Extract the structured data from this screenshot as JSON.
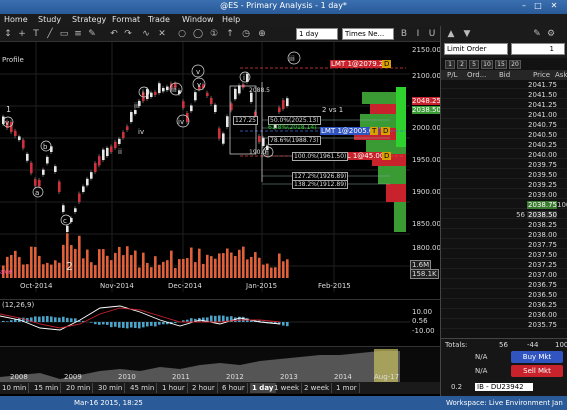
{
  "window": {
    "title": "@ES - Primary Analysis - 1 day*"
  },
  "menu": [
    "Home",
    "Study",
    "Strategy",
    "Format",
    "Trade",
    "Window",
    "Help"
  ],
  "toolbar": {
    "interval": "1 day",
    "font": "Times Ne..."
  },
  "chart": {
    "profile_label": "Profile",
    "price_axis": [
      "2150.00",
      "2100.00",
      "2050.00",
      "2000.00",
      "1950.00",
      "1900.00",
      "1850.00",
      "1800.00"
    ],
    "price_tags": [
      "2048.25",
      "2038.50"
    ],
    "date_axis": [
      "Oct-2014",
      "Nov-2014",
      "Dec-2014",
      "Jan-2015",
      "Feb-2015"
    ],
    "wave_labels": [
      "1",
      "v",
      "b",
      "a",
      "c",
      "ii",
      "iii",
      "iv",
      "i",
      "v",
      "iii",
      "iv",
      "i",
      "ii",
      "iii",
      "2",
      "v"
    ],
    "orders": {
      "lmt1": "LMT 1@2079.25",
      "lmt2": "LMT 1@2005.00",
      "trail": "TRAIL 1@45.00",
      "tag_d": "D",
      "tag_t": "T"
    },
    "fib_labels": [
      "50.0%(2025.13)",
      "61.8%(2018.14)",
      "78.6%(1988.73)",
      "100.0%(1961.50)",
      "127.2%(1926.89)",
      "138.2%(1912.89)"
    ],
    "box_values": [
      "127.25",
      "2088.5",
      "190.0"
    ],
    "two_vs_one": "2 vs 1",
    "volume_tags": [
      "1.6M",
      "158.1K"
    ],
    "volume_label": "ave"
  },
  "indicator": {
    "label": "(12,26,9)",
    "ticks": [
      "10.00",
      "0.56",
      "-10.00"
    ]
  },
  "overview": {
    "years": [
      "2008",
      "2009",
      "2010",
      "2011",
      "2012",
      "2013",
      "2014",
      "Aug-17"
    ]
  },
  "periods": [
    "10 min",
    "15 min",
    "20 min",
    "30 min",
    "45 min",
    "1 hour",
    "2 hour",
    "6 hour",
    "1 day",
    "1 week",
    "2 week",
    "1 mor"
  ],
  "active_period": "1 day",
  "status": {
    "left": "Mar-16 2015, 18:25",
    "workspace": "Workspace: Live Environment",
    "date": "Jan"
  },
  "dom": {
    "order_type": "Limit Order",
    "qty": "1",
    "qty_tabs": [
      "1",
      "2",
      "5",
      "10",
      "15",
      "20"
    ],
    "columns": [
      "P/L",
      "Ord...",
      "Bid",
      "Price",
      "Ask"
    ],
    "ladder": [
      {
        "price": "2041.75",
        "bid": "",
        "ask": ""
      },
      {
        "price": "2041.50",
        "bid": "",
        "ask": ""
      },
      {
        "price": "2041.25",
        "bid": "",
        "ask": ""
      },
      {
        "price": "2041.00",
        "bid": "",
        "ask": ""
      },
      {
        "price": "2040.75",
        "bid": "",
        "ask": ""
      },
      {
        "price": "2040.50",
        "bid": "",
        "ask": ""
      },
      {
        "price": "2040.25",
        "bid": "",
        "ask": ""
      },
      {
        "price": "2040.00",
        "bid": "",
        "ask": ""
      },
      {
        "price": "2039.75",
        "bid": "",
        "ask": ""
      },
      {
        "price": "2039.50",
        "bid": "",
        "ask": ""
      },
      {
        "price": "2039.25",
        "bid": "",
        "ask": ""
      },
      {
        "price": "2039.00",
        "bid": "",
        "ask": ""
      },
      {
        "price": "2038.75",
        "bid": "",
        "ask": "100"
      },
      {
        "price": "2038.50",
        "bid": "56",
        "ask": ""
      },
      {
        "price": "2038.25",
        "bid": "",
        "ask": ""
      },
      {
        "price": "2038.00",
        "bid": "",
        "ask": ""
      },
      {
        "price": "2037.75",
        "bid": "",
        "ask": ""
      },
      {
        "price": "2037.50",
        "bid": "",
        "ask": ""
      },
      {
        "price": "2037.25",
        "bid": "",
        "ask": ""
      },
      {
        "price": "2037.00",
        "bid": "",
        "ask": ""
      },
      {
        "price": "2036.75",
        "bid": "",
        "ask": ""
      },
      {
        "price": "2036.50",
        "bid": "",
        "ask": ""
      },
      {
        "price": "2036.25",
        "bid": "",
        "ask": ""
      },
      {
        "price": "2036.00",
        "bid": "",
        "ask": ""
      },
      {
        "price": "2035.75",
        "bid": "",
        "ask": ""
      }
    ],
    "totals_label": "Totals:",
    "totals": [
      "56",
      "-44",
      "100"
    ],
    "na1": "N/A",
    "na2": "N/A",
    "buy_label": "Buy Mkt",
    "sell_label": "Sell Mkt",
    "account_qty": "0.2",
    "account": "IB - DU23942"
  }
}
